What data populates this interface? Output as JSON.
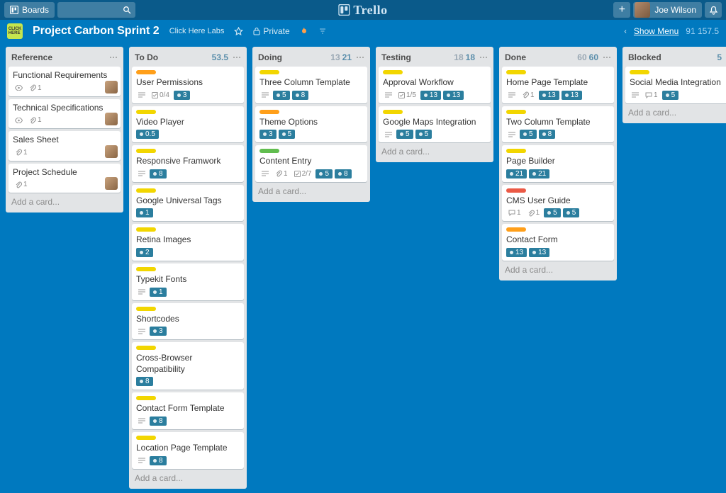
{
  "header": {
    "boards_btn": "Boards",
    "app_name": "Trello",
    "user_name": "Joe Wilson",
    "stats_muted": "91",
    "stats_bold": "157.5"
  },
  "board": {
    "title": "Project Carbon Sprint 2",
    "org": "Click Here Labs",
    "visibility": "Private",
    "show_menu": "Show Menu"
  },
  "add_card_text": "Add a card...",
  "lists": [
    {
      "name": "Reference",
      "count_muted": "",
      "count_main": "",
      "cards": [
        {
          "label": "",
          "title": "Functional Requirements",
          "badges": [
            {
              "type": "eye"
            },
            {
              "type": "attach",
              "val": "1"
            }
          ],
          "avatar": true
        },
        {
          "label": "",
          "title": "Technical Specifications",
          "badges": [
            {
              "type": "eye"
            },
            {
              "type": "attach",
              "val": "1"
            }
          ],
          "avatar": true
        },
        {
          "label": "",
          "title": "Sales Sheet",
          "badges": [
            {
              "type": "attach",
              "val": "1"
            }
          ],
          "avatar": true
        },
        {
          "label": "",
          "title": "Project Schedule",
          "badges": [
            {
              "type": "attach",
              "val": "1"
            }
          ],
          "avatar": true
        }
      ]
    },
    {
      "name": "To Do",
      "count_muted": "",
      "count_main": "53.5",
      "cards": [
        {
          "label": "orange",
          "title": "User Permissions",
          "badges": [
            {
              "type": "desc"
            },
            {
              "type": "check",
              "val": "0/4"
            },
            {
              "type": "box",
              "val": "3"
            }
          ]
        },
        {
          "label": "yellow",
          "title": "Video Player",
          "badges": [
            {
              "type": "box",
              "val": "0.5"
            }
          ]
        },
        {
          "label": "yellow",
          "title": "Responsive Framwork",
          "badges": [
            {
              "type": "desc"
            },
            {
              "type": "box",
              "val": "8"
            }
          ]
        },
        {
          "label": "yellow",
          "title": "Google Universal Tags",
          "badges": [
            {
              "type": "box",
              "val": "1"
            }
          ]
        },
        {
          "label": "yellow",
          "title": "Retina Images",
          "badges": [
            {
              "type": "box",
              "val": "2"
            }
          ]
        },
        {
          "label": "yellow",
          "title": "Typekit Fonts",
          "badges": [
            {
              "type": "desc"
            },
            {
              "type": "box",
              "val": "1"
            }
          ]
        },
        {
          "label": "yellow",
          "title": "Shortcodes",
          "badges": [
            {
              "type": "desc"
            },
            {
              "type": "box",
              "val": "3"
            }
          ]
        },
        {
          "label": "yellow",
          "title": "Cross-Browser Compatibility",
          "badges": [
            {
              "type": "box",
              "val": "8"
            }
          ]
        },
        {
          "label": "yellow",
          "title": "Contact Form Template",
          "badges": [
            {
              "type": "desc"
            },
            {
              "type": "box",
              "val": "8"
            }
          ]
        },
        {
          "label": "yellow",
          "title": "Location Page Template",
          "badges": [
            {
              "type": "desc"
            },
            {
              "type": "box",
              "val": "8"
            }
          ]
        }
      ]
    },
    {
      "name": "Doing",
      "count_muted": "13",
      "count_main": "21",
      "cards": [
        {
          "label": "yellow",
          "title": "Three Column Template",
          "badges": [
            {
              "type": "desc"
            },
            {
              "type": "box",
              "val": "5"
            },
            {
              "type": "box",
              "val": "8"
            }
          ]
        },
        {
          "label": "orange",
          "title": "Theme Options",
          "badges": [
            {
              "type": "box",
              "val": "3"
            },
            {
              "type": "box",
              "val": "5"
            }
          ]
        },
        {
          "label": "green",
          "title": "Content Entry",
          "badges": [
            {
              "type": "desc"
            },
            {
              "type": "attach",
              "val": "1"
            },
            {
              "type": "check",
              "val": "2/7"
            },
            {
              "type": "box",
              "val": "5"
            },
            {
              "type": "box",
              "val": "8"
            }
          ]
        }
      ]
    },
    {
      "name": "Testing",
      "count_muted": "18",
      "count_main": "18",
      "cards": [
        {
          "label": "yellow",
          "title": "Approval Workflow",
          "badges": [
            {
              "type": "desc"
            },
            {
              "type": "check",
              "val": "1/5"
            },
            {
              "type": "box",
              "val": "13"
            },
            {
              "type": "box",
              "val": "13"
            }
          ]
        },
        {
          "label": "yellow",
          "title": "Google Maps Integration",
          "badges": [
            {
              "type": "desc"
            },
            {
              "type": "box",
              "val": "5"
            },
            {
              "type": "box",
              "val": "5"
            }
          ]
        }
      ]
    },
    {
      "name": "Done",
      "count_muted": "60",
      "count_main": "60",
      "cards": [
        {
          "label": "yellow",
          "title": "Home Page Template",
          "badges": [
            {
              "type": "desc"
            },
            {
              "type": "attach",
              "val": "1"
            },
            {
              "type": "box",
              "val": "13"
            },
            {
              "type": "box",
              "val": "13"
            }
          ]
        },
        {
          "label": "yellow",
          "title": "Two Column Template",
          "badges": [
            {
              "type": "desc"
            },
            {
              "type": "box",
              "val": "5"
            },
            {
              "type": "box",
              "val": "8"
            }
          ]
        },
        {
          "label": "yellow",
          "title": "Page Builder",
          "badges": [
            {
              "type": "box",
              "val": "21"
            },
            {
              "type": "box",
              "val": "21"
            }
          ]
        },
        {
          "label": "red",
          "title": "CMS User Guide",
          "badges": [
            {
              "type": "comment",
              "val": "1"
            },
            {
              "type": "attach",
              "val": "1"
            },
            {
              "type": "box",
              "val": "5"
            },
            {
              "type": "box",
              "val": "5"
            }
          ]
        },
        {
          "label": "orange",
          "title": "Contact Form",
          "badges": [
            {
              "type": "box",
              "val": "13"
            },
            {
              "type": "box",
              "val": "13"
            }
          ]
        }
      ]
    },
    {
      "name": "Blocked",
      "count_muted": "",
      "count_main": "5",
      "cards": [
        {
          "label": "yellow",
          "title": "Social Media Integration",
          "badges": [
            {
              "type": "desc"
            },
            {
              "type": "comment",
              "val": "1"
            },
            {
              "type": "box",
              "val": "5"
            }
          ]
        }
      ]
    }
  ]
}
